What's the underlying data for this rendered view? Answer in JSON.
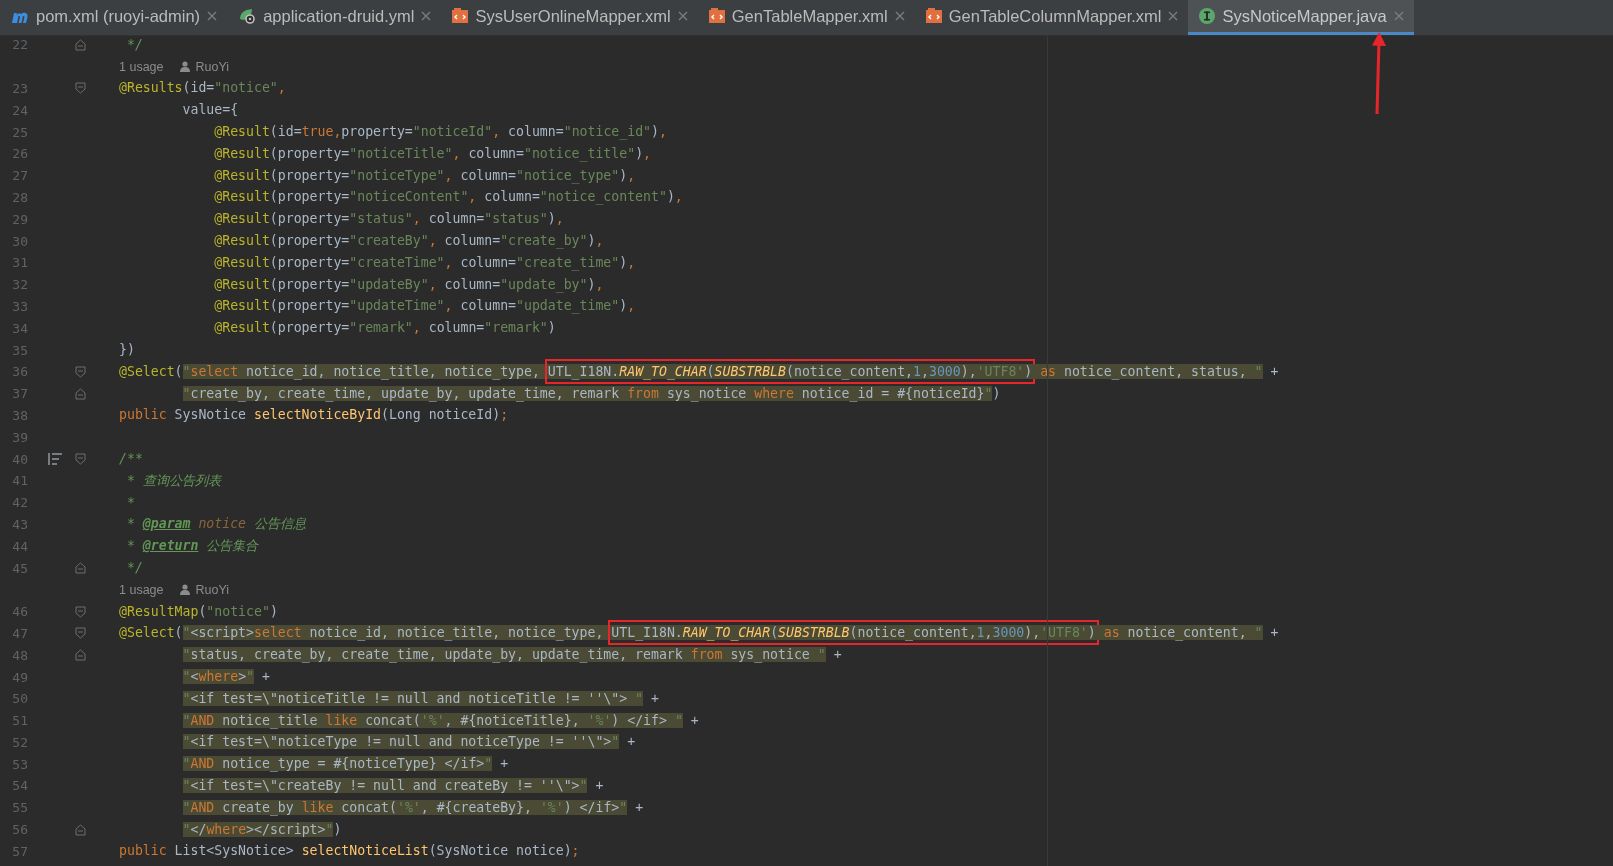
{
  "tabs": [
    {
      "label": "pom.xml (ruoyi-admin)",
      "kind": "maven",
      "selected": false
    },
    {
      "label": "application-druid.yml",
      "kind": "yaml",
      "selected": false
    },
    {
      "label": "SysUserOnlineMapper.xml",
      "kind": "xml",
      "selected": false
    },
    {
      "label": "GenTableMapper.xml",
      "kind": "xml",
      "selected": false
    },
    {
      "label": "GenTableColumnMapper.xml",
      "kind": "xml",
      "selected": false
    },
    {
      "label": "SysNoticeMapper.java",
      "kind": "interface",
      "selected": true
    }
  ],
  "editor": {
    "rows": [
      {
        "kind": "fold-end",
        "number": "22",
        "tokens": [
          {
            "kind": "comment",
            "text": " */"
          }
        ]
      },
      {
        "kind": "hint",
        "usage": "1 usage",
        "author": "RuoYi"
      },
      {
        "kind": "fold-start",
        "number": "23",
        "tokens": [
          {
            "kind": "ann",
            "text": "@Results"
          },
          {
            "kind": "plain",
            "text": "(id="
          },
          {
            "kind": "str",
            "text": "\"notice\""
          },
          {
            "kind": "kw",
            "text": ","
          }
        ]
      },
      {
        "kind": "code",
        "number": "24",
        "tokens": [
          {
            "kind": "plain",
            "text": "        value={"
          }
        ]
      },
      {
        "kind": "code",
        "number": "25",
        "tokens": [
          {
            "kind": "ann",
            "text": "            @Result"
          },
          {
            "kind": "plain",
            "text": "(id="
          },
          {
            "kind": "kw",
            "text": "true,"
          },
          {
            "kind": "plain",
            "text": "property="
          },
          {
            "kind": "str",
            "text": "\"noticeId\""
          },
          {
            "kind": "kw",
            "text": ","
          },
          {
            "kind": "plain",
            "text": " column="
          },
          {
            "kind": "str",
            "text": "\"notice_id\""
          },
          {
            "kind": "plain",
            "text": ")"
          },
          {
            "kind": "kw",
            "text": ","
          }
        ]
      },
      {
        "kind": "code",
        "number": "26",
        "tokens": [
          {
            "kind": "ann",
            "text": "            @Result"
          },
          {
            "kind": "plain",
            "text": "(property="
          },
          {
            "kind": "str",
            "text": "\"noticeTitle\""
          },
          {
            "kind": "kw",
            "text": ","
          },
          {
            "kind": "plain",
            "text": " column="
          },
          {
            "kind": "str",
            "text": "\"notice_title\""
          },
          {
            "kind": "plain",
            "text": ")"
          },
          {
            "kind": "kw",
            "text": ","
          }
        ]
      },
      {
        "kind": "code",
        "number": "27",
        "tokens": [
          {
            "kind": "ann",
            "text": "            @Result"
          },
          {
            "kind": "plain",
            "text": "(property="
          },
          {
            "kind": "str",
            "text": "\"noticeType\""
          },
          {
            "kind": "kw",
            "text": ","
          },
          {
            "kind": "plain",
            "text": " column="
          },
          {
            "kind": "str",
            "text": "\"notice_type\""
          },
          {
            "kind": "plain",
            "text": ")"
          },
          {
            "kind": "kw",
            "text": ","
          }
        ]
      },
      {
        "kind": "code",
        "number": "28",
        "tokens": [
          {
            "kind": "ann",
            "text": "            @Result"
          },
          {
            "kind": "plain",
            "text": "(property="
          },
          {
            "kind": "str",
            "text": "\"noticeContent\""
          },
          {
            "kind": "kw",
            "text": ","
          },
          {
            "kind": "plain",
            "text": " column="
          },
          {
            "kind": "str",
            "text": "\"notice_content\""
          },
          {
            "kind": "plain",
            "text": ")"
          },
          {
            "kind": "kw",
            "text": ","
          }
        ]
      },
      {
        "kind": "code",
        "number": "29",
        "tokens": [
          {
            "kind": "ann",
            "text": "            @Result"
          },
          {
            "kind": "plain",
            "text": "(property="
          },
          {
            "kind": "str",
            "text": "\"status\""
          },
          {
            "kind": "kw",
            "text": ","
          },
          {
            "kind": "plain",
            "text": " column="
          },
          {
            "kind": "str",
            "text": "\"status\""
          },
          {
            "kind": "plain",
            "text": ")"
          },
          {
            "kind": "kw",
            "text": ","
          }
        ]
      },
      {
        "kind": "code",
        "number": "30",
        "tokens": [
          {
            "kind": "ann",
            "text": "            @Result"
          },
          {
            "kind": "plain",
            "text": "(property="
          },
          {
            "kind": "str",
            "text": "\"createBy\""
          },
          {
            "kind": "kw",
            "text": ","
          },
          {
            "kind": "plain",
            "text": " column="
          },
          {
            "kind": "str",
            "text": "\"create_by\""
          },
          {
            "kind": "plain",
            "text": ")"
          },
          {
            "kind": "kw",
            "text": ","
          }
        ]
      },
      {
        "kind": "code",
        "number": "31",
        "tokens": [
          {
            "kind": "ann",
            "text": "            @Result"
          },
          {
            "kind": "plain",
            "text": "(property="
          },
          {
            "kind": "str",
            "text": "\"createTime\""
          },
          {
            "kind": "kw",
            "text": ","
          },
          {
            "kind": "plain",
            "text": " column="
          },
          {
            "kind": "str",
            "text": "\"create_time\""
          },
          {
            "kind": "plain",
            "text": ")"
          },
          {
            "kind": "kw",
            "text": ","
          }
        ]
      },
      {
        "kind": "code",
        "number": "32",
        "tokens": [
          {
            "kind": "ann",
            "text": "            @Result"
          },
          {
            "kind": "plain",
            "text": "(property="
          },
          {
            "kind": "str",
            "text": "\"updateBy\""
          },
          {
            "kind": "kw",
            "text": ","
          },
          {
            "kind": "plain",
            "text": " column="
          },
          {
            "kind": "str",
            "text": "\"update_by\""
          },
          {
            "kind": "plain",
            "text": ")"
          },
          {
            "kind": "kw",
            "text": ","
          }
        ]
      },
      {
        "kind": "code",
        "number": "33",
        "tokens": [
          {
            "kind": "ann",
            "text": "            @Result"
          },
          {
            "kind": "plain",
            "text": "(property="
          },
          {
            "kind": "str",
            "text": "\"updateTime\""
          },
          {
            "kind": "kw",
            "text": ","
          },
          {
            "kind": "plain",
            "text": " column="
          },
          {
            "kind": "str",
            "text": "\"update_time\""
          },
          {
            "kind": "plain",
            "text": ")"
          },
          {
            "kind": "kw",
            "text": ","
          }
        ]
      },
      {
        "kind": "code",
        "number": "34",
        "tokens": [
          {
            "kind": "ann",
            "text": "            @Result"
          },
          {
            "kind": "plain",
            "text": "(property="
          },
          {
            "kind": "str",
            "text": "\"remark\""
          },
          {
            "kind": "kw",
            "text": ","
          },
          {
            "kind": "plain",
            "text": " column="
          },
          {
            "kind": "str",
            "text": "\"remark\""
          },
          {
            "kind": "plain",
            "text": ")"
          }
        ]
      },
      {
        "kind": "code",
        "number": "35",
        "tokens": [
          {
            "kind": "plain",
            "text": "})"
          }
        ]
      },
      {
        "kind": "fold-start",
        "number": "36",
        "tokens": [
          {
            "kind": "ann",
            "text": "@Select"
          },
          {
            "kind": "plain",
            "text": "("
          },
          {
            "kind": "sqlstr",
            "text": "\""
          },
          {
            "kind": "sqlkw",
            "text": "select"
          },
          {
            "kind": "sql",
            "text": " notice_id, notice_title, notice_type, "
          },
          {
            "kind": "box",
            "tokens": [
              {
                "kind": "sql",
                "text": "UTL_I18N."
              },
              {
                "kind": "sqlfn",
                "text": "RAW_TO_CHAR"
              },
              {
                "kind": "sql",
                "text": "("
              },
              {
                "kind": "sqlfn",
                "text": "SUBSTRBLB"
              },
              {
                "kind": "sql",
                "text": "(notice_content,"
              },
              {
                "kind": "sqlnum",
                "text": "1"
              },
              {
                "kind": "sql",
                "text": ","
              },
              {
                "kind": "sqlnum",
                "text": "3000"
              },
              {
                "kind": "sql",
                "text": "),"
              },
              {
                "kind": "sqlstr",
                "text": "'UTF8'"
              },
              {
                "kind": "sql",
                "text": ")"
              }
            ]
          },
          {
            "kind": "sqlkw",
            "text": " as"
          },
          {
            "kind": "sql",
            "text": " notice_content, status, "
          },
          {
            "kind": "sqlstr",
            "text": "\""
          },
          {
            "kind": "plain",
            "text": " +"
          }
        ]
      },
      {
        "kind": "fold-end",
        "number": "37",
        "tokens": [
          {
            "kind": "sqlstr",
            "text": "        \""
          },
          {
            "kind": "sql",
            "text": "create_by, create_time, update_by, update_time, remark "
          },
          {
            "kind": "sqlkw",
            "text": "from"
          },
          {
            "kind": "sql",
            "text": " sys_notice "
          },
          {
            "kind": "sqlkw",
            "text": "where"
          },
          {
            "kind": "sql",
            "text": " notice_id = #{noticeId}"
          },
          {
            "kind": "sqlstr",
            "text": "\""
          },
          {
            "kind": "plain",
            "text": ")"
          }
        ]
      },
      {
        "kind": "code",
        "number": "38",
        "tokens": [
          {
            "kind": "kw",
            "text": "public"
          },
          {
            "kind": "plain",
            "text": " SysNotice "
          },
          {
            "kind": "method",
            "text": "selectNoticeById"
          },
          {
            "kind": "plain",
            "text": "(Long noticeId)"
          },
          {
            "kind": "kw",
            "text": ";"
          }
        ]
      },
      {
        "kind": "code",
        "number": "39",
        "tokens": []
      },
      {
        "kind": "fold-start",
        "number": "40",
        "doc": true,
        "tokens": [
          {
            "kind": "comment",
            "text": "/**"
          }
        ]
      },
      {
        "kind": "code",
        "number": "41",
        "tokens": [
          {
            "kind": "comment",
            "text": " * 查询公告列表"
          }
        ]
      },
      {
        "kind": "code",
        "number": "42",
        "tokens": [
          {
            "kind": "comment",
            "text": " *"
          }
        ]
      },
      {
        "kind": "code",
        "number": "43",
        "tokens": [
          {
            "kind": "comment",
            "text": " * "
          },
          {
            "kind": "doctag",
            "text": "@param"
          },
          {
            "kind": "docparam",
            "text": " notice"
          },
          {
            "kind": "comment",
            "text": " 公告信息"
          }
        ]
      },
      {
        "kind": "code",
        "number": "44",
        "tokens": [
          {
            "kind": "comment",
            "text": " * "
          },
          {
            "kind": "doctag",
            "text": "@return"
          },
          {
            "kind": "comment",
            "text": " 公告集合"
          }
        ]
      },
      {
        "kind": "fold-end",
        "number": "45",
        "tokens": [
          {
            "kind": "comment",
            "text": " */"
          }
        ]
      },
      {
        "kind": "hint",
        "usage": "1 usage",
        "author": "RuoYi"
      },
      {
        "kind": "fold-start",
        "number": "46",
        "tokens": [
          {
            "kind": "ann",
            "text": "@ResultMap"
          },
          {
            "kind": "plain",
            "text": "("
          },
          {
            "kind": "str",
            "text": "\"notice\""
          },
          {
            "kind": "plain",
            "text": ")"
          }
        ]
      },
      {
        "kind": "fold-start",
        "number": "47",
        "tokens": [
          {
            "kind": "ann",
            "text": "@Select"
          },
          {
            "kind": "plain",
            "text": "("
          },
          {
            "kind": "sqlstr",
            "text": "\""
          },
          {
            "kind": "sql",
            "text": "<script>"
          },
          {
            "kind": "sqlkw",
            "text": "select"
          },
          {
            "kind": "sql",
            "text": " notice_id, notice_title, notice_type, "
          },
          {
            "kind": "box",
            "tokens": [
              {
                "kind": "sql",
                "text": "UTL_I18N."
              },
              {
                "kind": "sqlfn",
                "text": "RAW_TO_CHAR"
              },
              {
                "kind": "sql",
                "text": "("
              },
              {
                "kind": "sqlfn",
                "text": "SUBSTRBLB"
              },
              {
                "kind": "sql",
                "text": "(notice_content,"
              },
              {
                "kind": "sqlnum",
                "text": "1"
              },
              {
                "kind": "sql",
                "text": ","
              },
              {
                "kind": "sqlnum",
                "text": "3000"
              },
              {
                "kind": "sql",
                "text": "),"
              },
              {
                "kind": "sqlstr",
                "text": "'UTF8'"
              },
              {
                "kind": "sql",
                "text": ")"
              }
            ]
          },
          {
            "kind": "sqlkw",
            "text": " as"
          },
          {
            "kind": "sql",
            "text": " notice_content, "
          },
          {
            "kind": "sqlstr",
            "text": "\""
          },
          {
            "kind": "plain",
            "text": " +"
          }
        ]
      },
      {
        "kind": "fold-end",
        "number": "48",
        "tokens": [
          {
            "kind": "sqlstr",
            "text": "        \""
          },
          {
            "kind": "sql",
            "text": "status, create_by, create_time, update_by, update_time, remark "
          },
          {
            "kind": "sqlkw",
            "text": "from"
          },
          {
            "kind": "sql",
            "text": " sys_notice "
          },
          {
            "kind": "sqlstr",
            "text": "\""
          },
          {
            "kind": "plain",
            "text": " +"
          }
        ]
      },
      {
        "kind": "code",
        "number": "49",
        "tokens": [
          {
            "kind": "sqlstr",
            "text": "        \""
          },
          {
            "kind": "sql",
            "text": "<"
          },
          {
            "kind": "sqlkw",
            "text": "where"
          },
          {
            "kind": "sql",
            "text": ">"
          },
          {
            "kind": "sqlstr",
            "text": "\""
          },
          {
            "kind": "plain",
            "text": " +"
          }
        ]
      },
      {
        "kind": "code",
        "number": "50",
        "tokens": [
          {
            "kind": "sqlstr",
            "text": "        \""
          },
          {
            "kind": "sql",
            "text": "<if test=\\\"noticeTitle != null and noticeTitle != ''\\\"> "
          },
          {
            "kind": "sqlstr",
            "text": "\""
          },
          {
            "kind": "plain",
            "text": " +"
          }
        ]
      },
      {
        "kind": "code",
        "number": "51",
        "tokens": [
          {
            "kind": "sqlstr",
            "text": "        \""
          },
          {
            "kind": "sqlkw",
            "text": "AND"
          },
          {
            "kind": "sql",
            "text": " notice_title "
          },
          {
            "kind": "sqlkw",
            "text": "like"
          },
          {
            "kind": "sql",
            "text": " concat("
          },
          {
            "kind": "sqlstr",
            "text": "'%'"
          },
          {
            "kind": "sql",
            "text": ", #{noticeTitle}, "
          },
          {
            "kind": "sqlstr",
            "text": "'%'"
          },
          {
            "kind": "sql",
            "text": ") </if> "
          },
          {
            "kind": "sqlstr",
            "text": "\""
          },
          {
            "kind": "plain",
            "text": " +"
          }
        ]
      },
      {
        "kind": "code",
        "number": "52",
        "tokens": [
          {
            "kind": "sqlstr",
            "text": "        \""
          },
          {
            "kind": "sql",
            "text": "<if test=\\\"noticeType != null and noticeType != ''\\\">"
          },
          {
            "kind": "sqlstr",
            "text": "\""
          },
          {
            "kind": "plain",
            "text": " +"
          }
        ]
      },
      {
        "kind": "code",
        "number": "53",
        "tokens": [
          {
            "kind": "sqlstr",
            "text": "        \""
          },
          {
            "kind": "sqlkw",
            "text": "AND"
          },
          {
            "kind": "sql",
            "text": " notice_type = #{noticeType} </if>"
          },
          {
            "kind": "sqlstr",
            "text": "\""
          },
          {
            "kind": "plain",
            "text": " +"
          }
        ]
      },
      {
        "kind": "code",
        "number": "54",
        "tokens": [
          {
            "kind": "sqlstr",
            "text": "        \""
          },
          {
            "kind": "sql",
            "text": "<if test=\\\"createBy != null and createBy != ''\\\">"
          },
          {
            "kind": "sqlstr",
            "text": "\""
          },
          {
            "kind": "plain",
            "text": " +"
          }
        ]
      },
      {
        "kind": "code",
        "number": "55",
        "tokens": [
          {
            "kind": "sqlstr",
            "text": "        \""
          },
          {
            "kind": "sqlkw",
            "text": "AND"
          },
          {
            "kind": "sql",
            "text": " create_by "
          },
          {
            "kind": "sqlkw",
            "text": "like"
          },
          {
            "kind": "sql",
            "text": " concat("
          },
          {
            "kind": "sqlstr",
            "text": "'%'"
          },
          {
            "kind": "sql",
            "text": ", #{createBy}, "
          },
          {
            "kind": "sqlstr",
            "text": "'%'"
          },
          {
            "kind": "sql",
            "text": ") </if>"
          },
          {
            "kind": "sqlstr",
            "text": "\""
          },
          {
            "kind": "plain",
            "text": " +"
          }
        ]
      },
      {
        "kind": "fold-end",
        "number": "56",
        "tokens": [
          {
            "kind": "sqlstr",
            "text": "        \""
          },
          {
            "kind": "sql",
            "text": "</"
          },
          {
            "kind": "sqlkw",
            "text": "where"
          },
          {
            "kind": "sql",
            "text": "></script>"
          },
          {
            "kind": "sqlstr",
            "text": "\""
          },
          {
            "kind": "plain",
            "text": ")"
          }
        ]
      },
      {
        "kind": "code",
        "number": "57",
        "tokens": [
          {
            "kind": "kw",
            "text": "public"
          },
          {
            "kind": "plain",
            "text": " List<SysNotice> "
          },
          {
            "kind": "method",
            "text": "selectNoticeList"
          },
          {
            "kind": "plain",
            "text": "(SysNotice notice)"
          },
          {
            "kind": "kw",
            "text": ";"
          }
        ]
      }
    ]
  }
}
